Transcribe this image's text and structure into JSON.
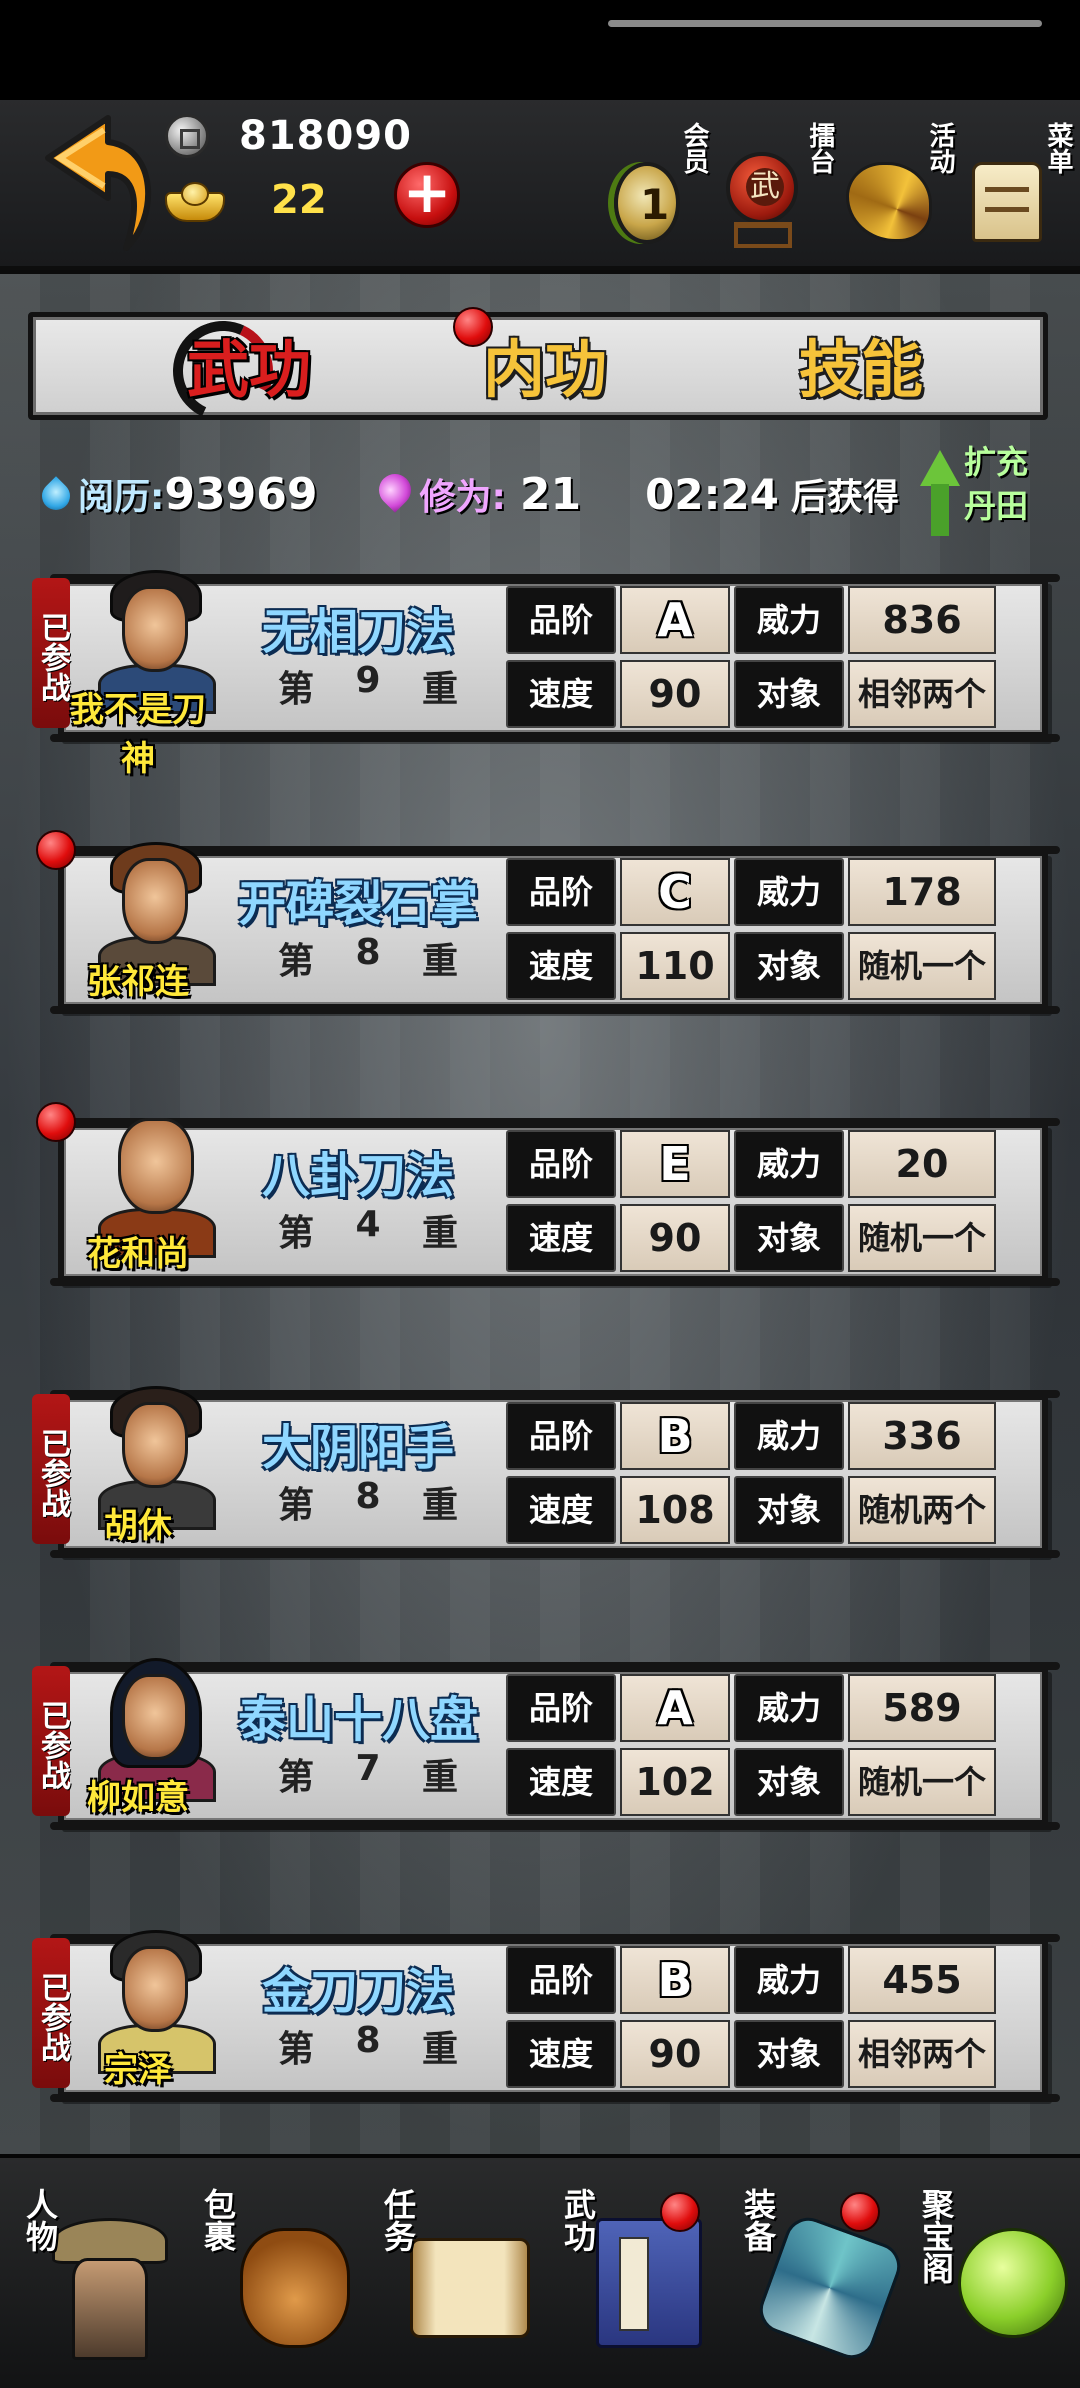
{
  "topbar": {
    "silver": "818090",
    "gold": "22",
    "icons": {
      "member": "会员",
      "arena": "擂台",
      "activity": "活动",
      "menu": "菜单"
    }
  },
  "tabs": [
    {
      "label": "武功",
      "active": true
    },
    {
      "label": "内功",
      "active": false,
      "badge": true
    },
    {
      "label": "技能",
      "active": false
    }
  ],
  "stats": {
    "exp_label": "阅历:",
    "exp_value": "93969",
    "cultivation_label": "修为:",
    "cultivation_value": "21",
    "timer": "02:24",
    "timer_suffix": "后获得",
    "expand_label": "扩充丹田"
  },
  "labels": {
    "grade": "品阶",
    "power": "威力",
    "speed": "速度",
    "target": "对象",
    "joined": "已参战",
    "level_prefix": "第",
    "level_suffix": "重"
  },
  "skills": [
    {
      "hero": "我不是刀神",
      "skill": "无相刀法",
      "level": "9",
      "grade": "A",
      "power": "836",
      "speed": "90",
      "target": "相邻两个",
      "joined": true,
      "badge": false
    },
    {
      "hero": "张祁连",
      "skill": "开碑裂石掌",
      "level": "8",
      "grade": "C",
      "power": "178",
      "speed": "110",
      "target": "随机一个",
      "joined": false,
      "badge": true
    },
    {
      "hero": "花和尚",
      "skill": "八卦刀法",
      "level": "4",
      "grade": "E",
      "power": "20",
      "speed": "90",
      "target": "随机一个",
      "joined": false,
      "badge": true
    },
    {
      "hero": "胡休",
      "skill": "大阴阳手",
      "level": "8",
      "grade": "B",
      "power": "336",
      "speed": "108",
      "target": "随机两个",
      "joined": true,
      "badge": false
    },
    {
      "hero": "柳如意",
      "skill": "泰山十八盘",
      "level": "7",
      "grade": "A",
      "power": "589",
      "speed": "102",
      "target": "随机一个",
      "joined": true,
      "badge": false
    },
    {
      "hero": "宗泽",
      "skill": "金刀刀法",
      "level": "8",
      "grade": "B",
      "power": "455",
      "speed": "90",
      "target": "相邻两个",
      "joined": true,
      "badge": false
    }
  ],
  "bottom_nav": [
    {
      "label": "人物",
      "icon": "person-icon",
      "badge": false
    },
    {
      "label": "包裹",
      "icon": "bag-icon",
      "badge": false
    },
    {
      "label": "任务",
      "icon": "scroll-icon",
      "badge": false
    },
    {
      "label": "武功",
      "icon": "book-icon",
      "badge": true
    },
    {
      "label": "装备",
      "icon": "equipment-icon",
      "badge": true
    },
    {
      "label": "聚宝阁",
      "icon": "treasure-icon",
      "badge": false
    }
  ],
  "colors": {
    "accent_red": "#e00d0d",
    "gold_text": "#ffe14a",
    "skill_blue": "#8fd7ff",
    "hero_yellow": "#ffe83a"
  }
}
